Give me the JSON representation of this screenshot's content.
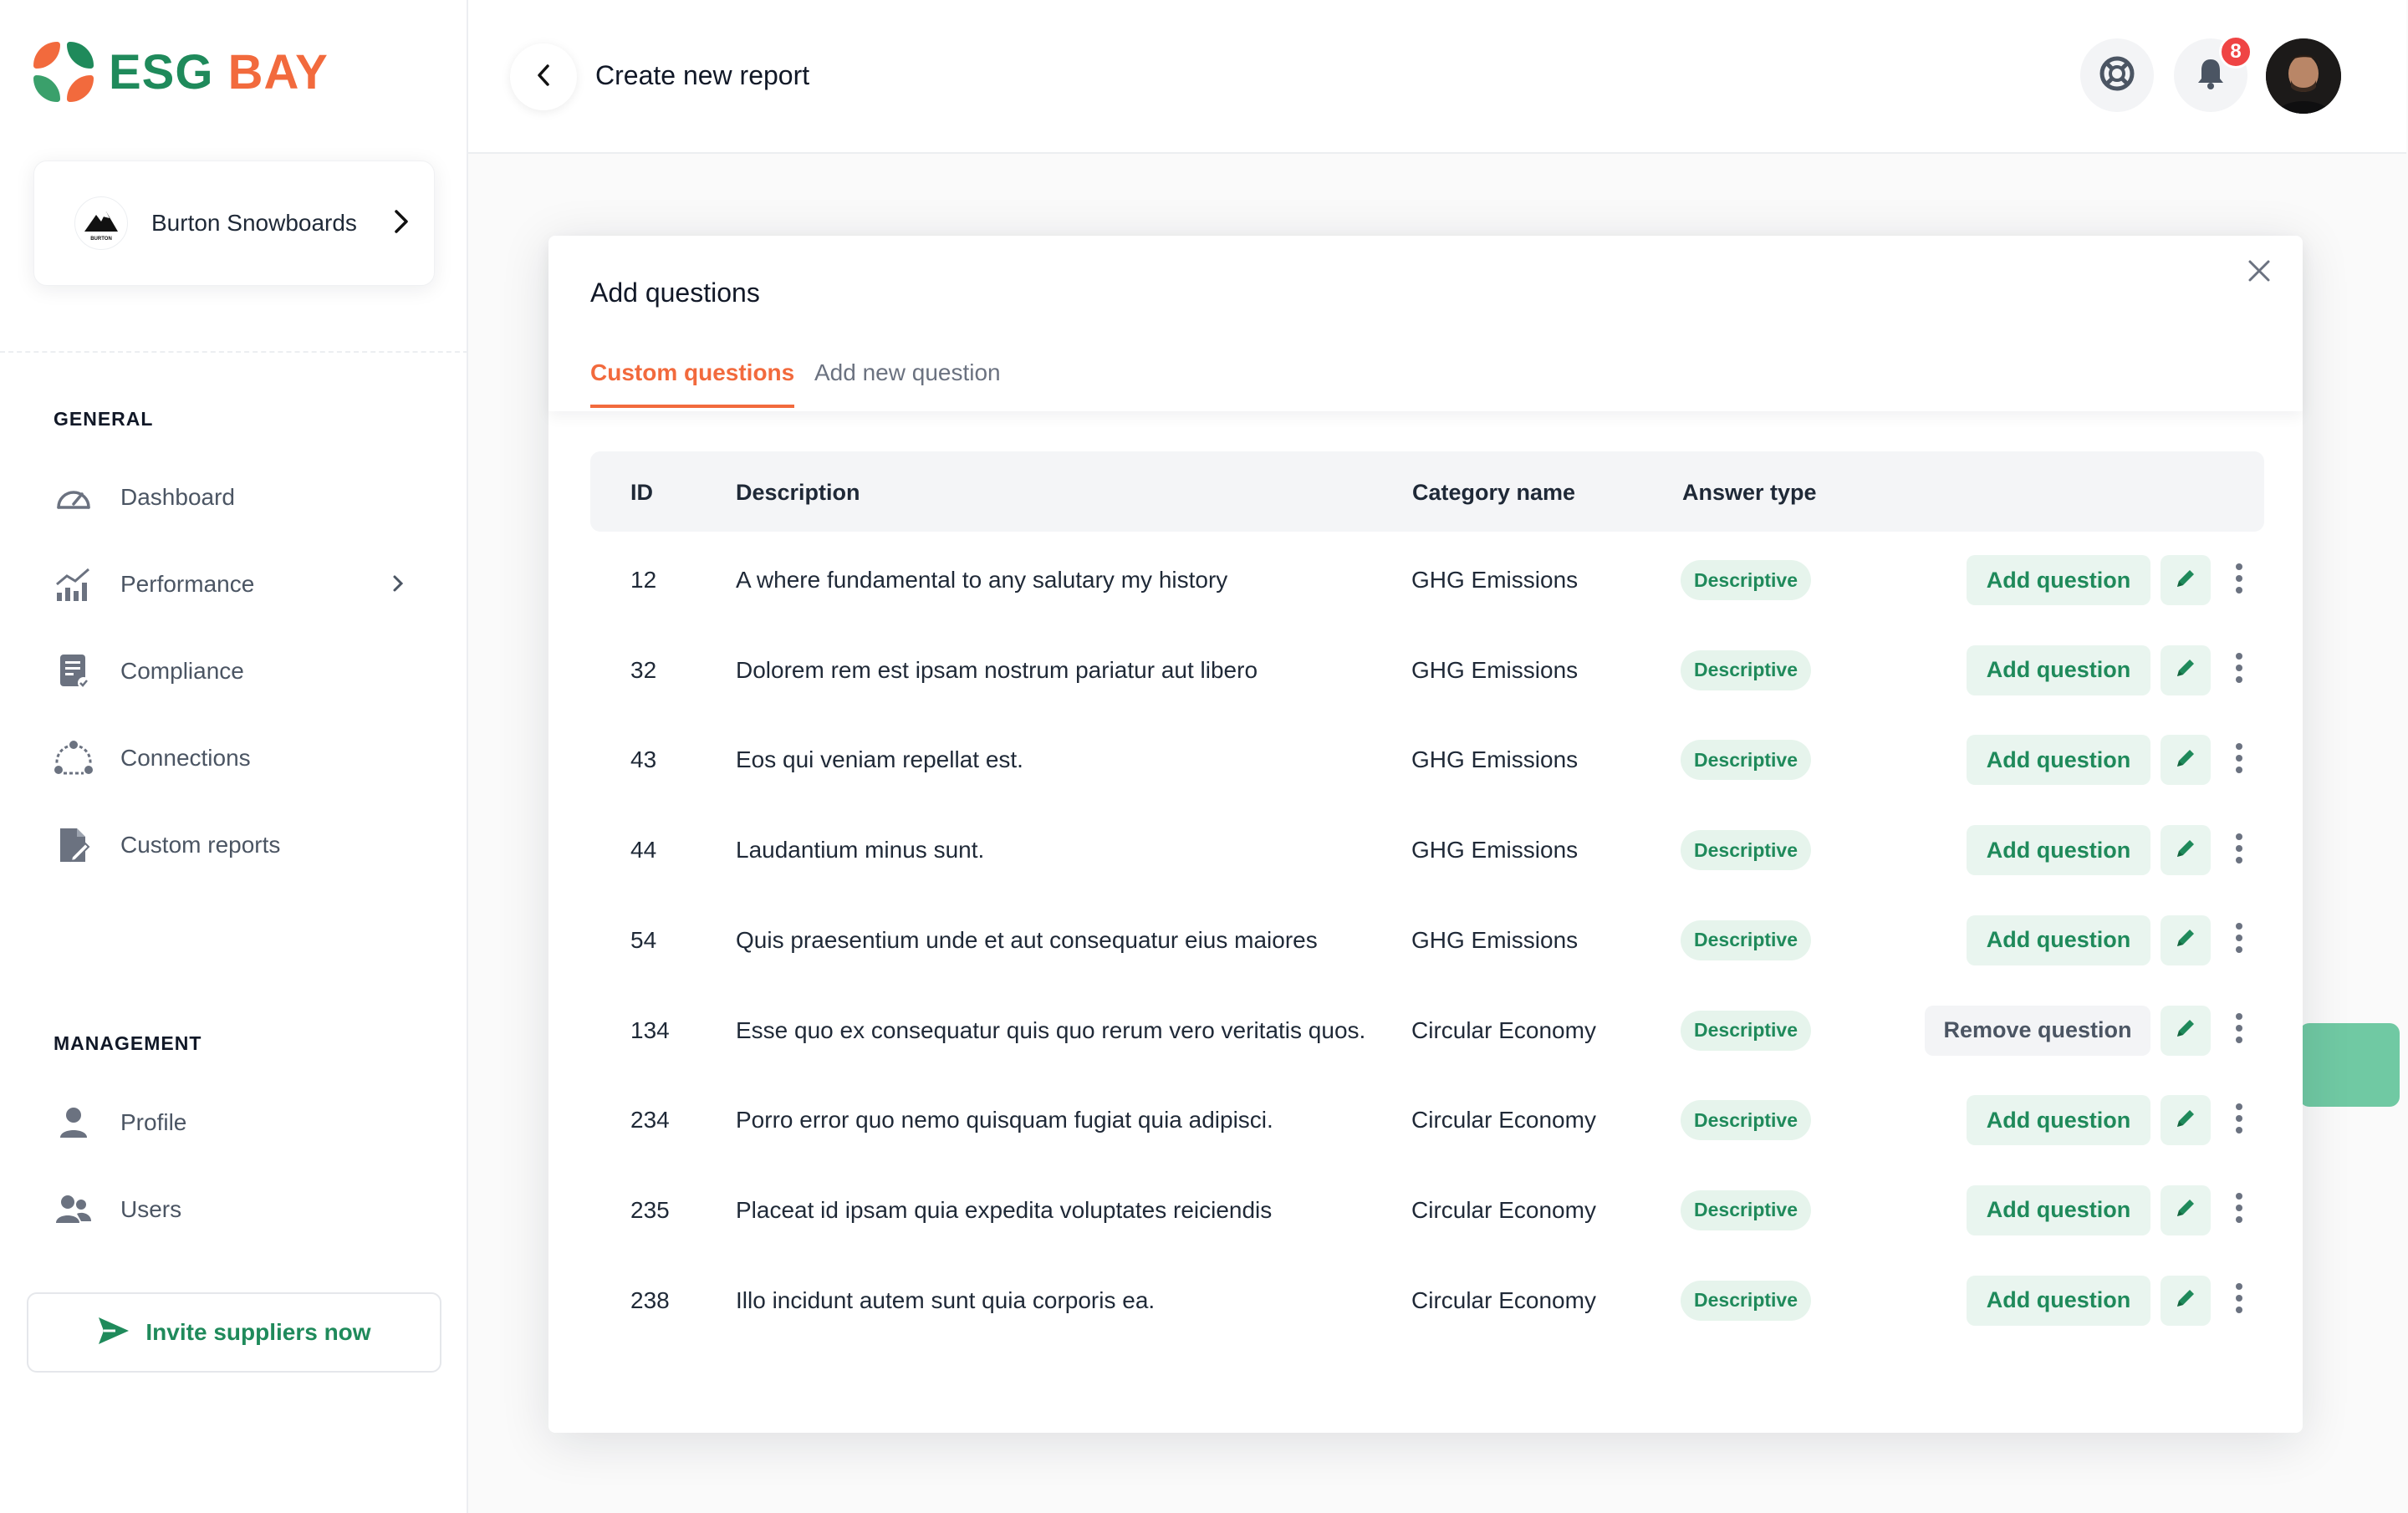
{
  "brand": {
    "esg": "ESG",
    "bay": "BAY",
    "primary_color": "#1f8a5b",
    "accent_color": "#f26a3d"
  },
  "org": {
    "name": "Burton Snowboards",
    "logo_text": "BURTON"
  },
  "sidebar": {
    "general_title": "GENERAL",
    "general_items": [
      {
        "label": "Dashboard",
        "icon": "gauge-icon"
      },
      {
        "label": "Performance",
        "icon": "bar-chart-icon",
        "has_chevron": true
      },
      {
        "label": "Compliance",
        "icon": "clipboard-check-icon"
      },
      {
        "label": "Connections",
        "icon": "network-icon"
      },
      {
        "label": "Custom reports",
        "icon": "document-edit-icon"
      }
    ],
    "management_title": "MANAGEMENT",
    "management_items": [
      {
        "label": "Profile",
        "icon": "user-icon"
      },
      {
        "label": "Users",
        "icon": "users-icon"
      }
    ],
    "invite_label": "Invite suppliers now"
  },
  "header": {
    "title": "Create new report",
    "notification_count": "8"
  },
  "modal": {
    "title": "Add questions",
    "tabs": [
      {
        "label": "Custom questions",
        "active": true
      },
      {
        "label": "Add new question",
        "active": false
      }
    ],
    "columns": {
      "id": "ID",
      "description": "Description",
      "category": "Category name",
      "answer_type": "Answer type"
    },
    "rows": [
      {
        "id": "12",
        "description": "A where fundamental to any salutary my history",
        "category": "GHG Emissions",
        "answer_type": "Descriptive",
        "action": "Add question"
      },
      {
        "id": "32",
        "description": "Dolorem rem est ipsam nostrum pariatur aut libero",
        "category": "GHG Emissions",
        "answer_type": "Descriptive",
        "action": "Add question"
      },
      {
        "id": "43",
        "description": "Eos qui veniam repellat est.",
        "category": "GHG Emissions",
        "answer_type": "Descriptive",
        "action": "Add question"
      },
      {
        "id": "44",
        "description": "Laudantium minus sunt.",
        "category": "GHG Emissions",
        "answer_type": "Descriptive",
        "action": "Add question"
      },
      {
        "id": "54",
        "description": "Quis praesentium unde et aut consequatur eius maiores",
        "category": "GHG Emissions",
        "answer_type": "Descriptive",
        "action": "Add question"
      },
      {
        "id": "134",
        "description": "Esse quo ex consequatur quis quo rerum vero veritatis quos.",
        "category": "Circular Economy",
        "answer_type": "Descriptive",
        "action": "Remove question"
      },
      {
        "id": "234",
        "description": "Porro error quo nemo quisquam fugiat quia adipisci.",
        "category": "Circular Economy",
        "answer_type": "Descriptive",
        "action": "Add question"
      },
      {
        "id": "235",
        "description": "Placeat id ipsam quia expedita voluptates reiciendis",
        "category": "Circular Economy",
        "answer_type": "Descriptive",
        "action": "Add question"
      },
      {
        "id": "238",
        "description": "Illo incidunt autem sunt quia corporis ea.",
        "category": "Circular Economy",
        "answer_type": "Descriptive",
        "action": "Add question"
      }
    ]
  }
}
